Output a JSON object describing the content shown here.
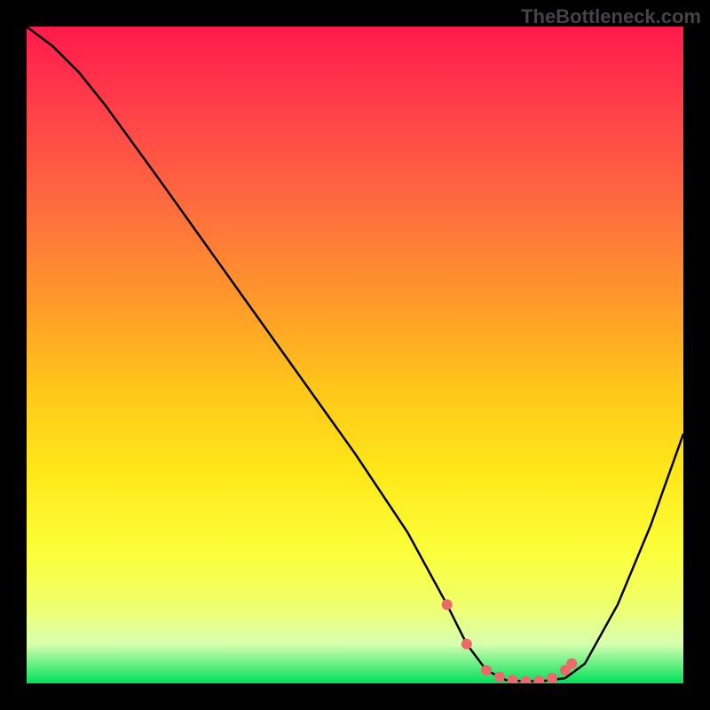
{
  "watermark": "TheBottleneck.com",
  "chart_data": {
    "type": "line",
    "title": "",
    "xlabel": "",
    "ylabel": "",
    "xlim": [
      0,
      100
    ],
    "ylim": [
      0,
      100
    ],
    "series": [
      {
        "name": "bottleneck-curve",
        "x": [
          0,
          4,
          8,
          12,
          20,
          30,
          40,
          50,
          58,
          64,
          67,
          70,
          73,
          76,
          79,
          82,
          85,
          90,
          95,
          100
        ],
        "y": [
          100,
          97,
          93,
          88,
          77,
          63,
          49,
          35,
          23,
          12,
          6,
          2,
          0.5,
          0.3,
          0.4,
          0.8,
          3,
          12,
          24,
          38
        ]
      }
    ],
    "markers": {
      "name": "highlighted-points",
      "color": "#e86a6a",
      "x": [
        64,
        67,
        70,
        72,
        74,
        76,
        78,
        80,
        82,
        83
      ],
      "y": [
        12,
        6,
        2,
        1,
        0.5,
        0.3,
        0.4,
        0.8,
        2,
        3
      ]
    }
  }
}
